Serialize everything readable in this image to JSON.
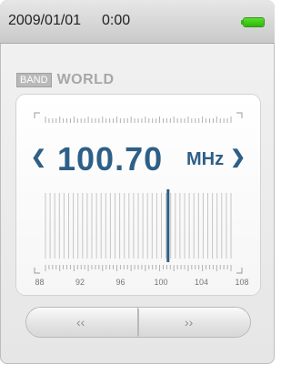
{
  "status_bar": {
    "date": "2009/01/01",
    "time": "0:00",
    "battery_icon": "battery-full-icon",
    "battery_color": "#3fcf1a"
  },
  "band": {
    "badge_label": "BAND",
    "name": "WORLD"
  },
  "tuner": {
    "frequency": "100.70",
    "unit": "MHz",
    "accent_color": "#2e5f86",
    "scale_labels": [
      "88",
      "92",
      "96",
      "100",
      "104",
      "108"
    ],
    "current_mhz": 100.7,
    "range_mhz": [
      87.5,
      108
    ]
  },
  "controls": {
    "seek_back_glyph": "‹‹",
    "seek_forward_glyph": "››"
  }
}
